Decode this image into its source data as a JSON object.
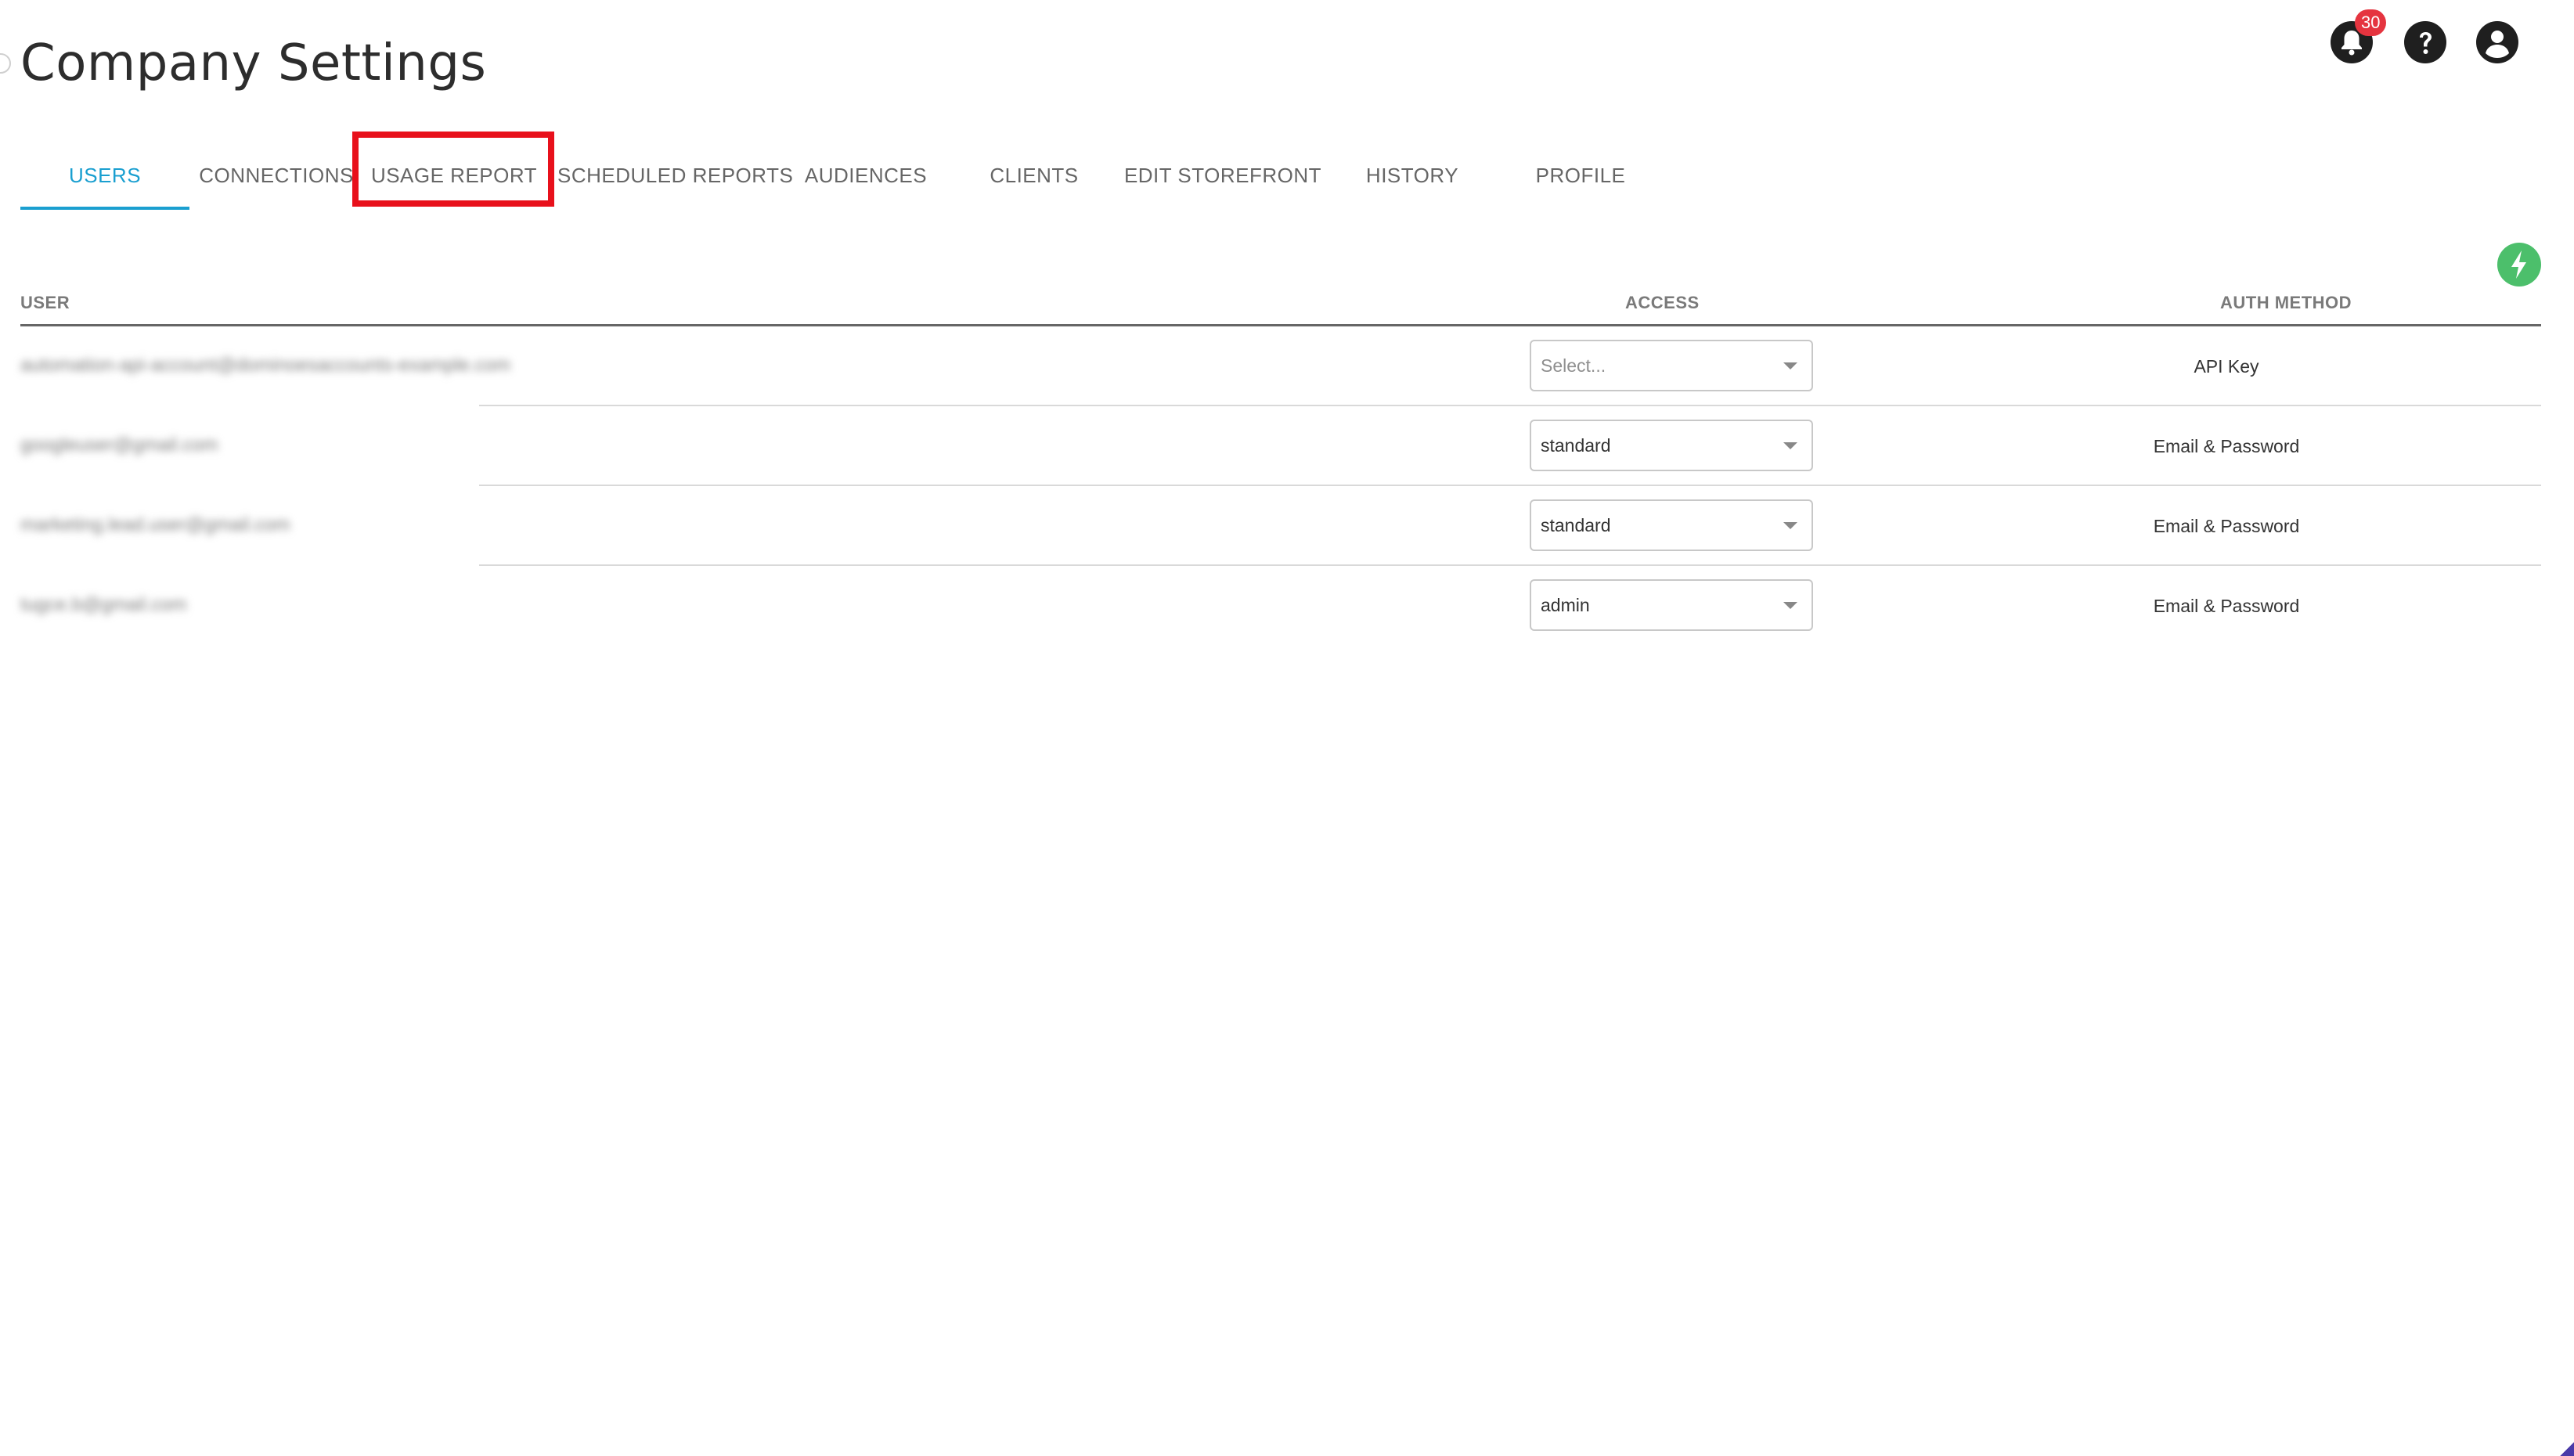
{
  "page": {
    "title": "Company Settings"
  },
  "header": {
    "notifications_count": "30",
    "icons": [
      "bell-icon",
      "help-icon",
      "account-icon"
    ]
  },
  "tabs": [
    {
      "label": "USERS",
      "active": true
    },
    {
      "label": "CONNECTIONS",
      "active": false
    },
    {
      "label": "USAGE REPORT",
      "active": false
    },
    {
      "label": "SCHEDULED REPORTS",
      "active": false
    },
    {
      "label": "AUDIENCES",
      "active": false
    },
    {
      "label": "CLIENTS",
      "active": false
    },
    {
      "label": "EDIT STOREFRONT",
      "active": false
    },
    {
      "label": "HISTORY",
      "active": false
    },
    {
      "label": "PROFILE",
      "active": false
    }
  ],
  "table": {
    "headers": {
      "user": "USER",
      "access": "ACCESS",
      "auth": "AUTH METHOD"
    },
    "rows": [
      {
        "email": "automation-api-account@dominoesaccounts-example.com",
        "access": "Select...",
        "access_placeholder": true,
        "auth": "API Key"
      },
      {
        "email": "googleuser@gmail.com",
        "access": "standard",
        "access_placeholder": false,
        "auth": "Email & Password"
      },
      {
        "email": "marketing.lead.user@gmail.com",
        "access": "standard",
        "access_placeholder": false,
        "auth": "Email & Password"
      },
      {
        "email": "tugce.b@gmail.com",
        "access": "admin",
        "access_placeholder": false,
        "auth": "Email & Password"
      }
    ]
  },
  "colors": {
    "accent": "#1a9fd0",
    "badge": "#e5343f",
    "highlight": "#e8101b",
    "action": "#4cbf6b"
  }
}
